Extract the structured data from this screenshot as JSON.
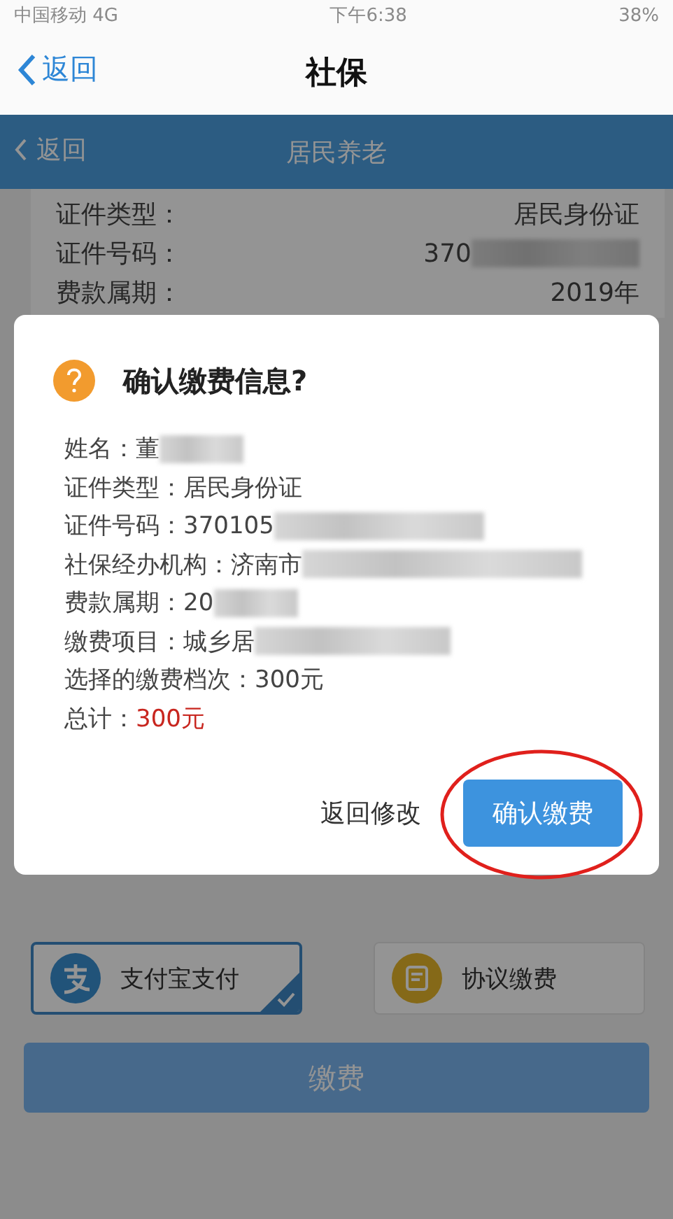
{
  "status_bar": {
    "carrier": "中国移动 4G",
    "time": "下午6:38",
    "battery": "38%"
  },
  "nav": {
    "back": "返回",
    "title": "社保"
  },
  "header": {
    "back": "返回",
    "title": "居民养老"
  },
  "info_rows": [
    {
      "label": "证件类型：",
      "value": "居民身份证",
      "redacted": false
    },
    {
      "label": "证件号码：",
      "value": "370",
      "redacted": true
    },
    {
      "label": "费款属期：",
      "value": "2019年",
      "redacted": false
    }
  ],
  "payment_methods": [
    {
      "label": "支付宝支付",
      "kind": "alipay",
      "selected": true
    },
    {
      "label": "协议缴费",
      "kind": "agreement",
      "selected": false
    }
  ],
  "pay_button": "缴费",
  "dialog": {
    "title": "确认缴费信息?",
    "rows": [
      {
        "label": "姓名：",
        "value": "董",
        "redacted": true
      },
      {
        "label": "证件类型：",
        "value": "居民身份证",
        "redacted": false
      },
      {
        "label": "证件号码：",
        "value": "370105",
        "redacted": true
      },
      {
        "label": "社保经办机构：",
        "value": "济南市",
        "redacted": true
      },
      {
        "label": "费款属期：",
        "value": "20",
        "redacted": true
      },
      {
        "label": "缴费项目：",
        "value": "城乡居",
        "redacted": true
      },
      {
        "label": "选择的缴费档次：",
        "value": "300元",
        "redacted": false
      }
    ],
    "total_label": "总计：",
    "total": "300元",
    "cancel": "返回修改",
    "confirm": "确认缴费",
    "highlighted": true
  }
}
